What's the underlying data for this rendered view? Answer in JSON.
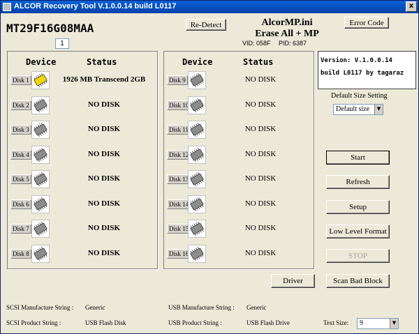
{
  "window": {
    "title": "ALCOR Recovery Tool V.1.0.0.14 build L0117",
    "close_glyph": "x"
  },
  "header": {
    "model": "MT29F16G08MAA",
    "number_field": "1",
    "redetect_label": "Re-Detect",
    "ini_title": "AlcorMP.ini",
    "ini_subtitle": "Erase All + MP",
    "vid": "VID: 058F",
    "pid": "PID: 6387",
    "error_code_label": "Error Code"
  },
  "panels": {
    "device_header": "Device",
    "status_header": "Status"
  },
  "left_disks": [
    {
      "label": "Disk 1",
      "status": "1926 MB Transcend 2GB",
      "icon": "chip-icon-active"
    },
    {
      "label": "Disk 2",
      "status": "NO DISK",
      "icon": "chip-icon"
    },
    {
      "label": "Disk 3",
      "status": "NO DISK",
      "icon": "chip-icon"
    },
    {
      "label": "Disk 4",
      "status": "NO DISK",
      "icon": "chip-icon"
    },
    {
      "label": "Disk 5",
      "status": "NO DISK",
      "icon": "chip-icon"
    },
    {
      "label": "Disk 6",
      "status": "NO DISK",
      "icon": "chip-icon"
    },
    {
      "label": "Disk 7",
      "status": "NO DISK",
      "icon": "chip-icon"
    },
    {
      "label": "Disk 8",
      "status": "NO DISK",
      "icon": "chip-icon"
    }
  ],
  "right_disks": [
    {
      "label": "Disk 9",
      "status": "NO DISK",
      "icon": "chip-icon"
    },
    {
      "label": "Disk 10",
      "status": "NO DISK",
      "icon": "chip-icon"
    },
    {
      "label": "Disk 11",
      "status": "NO DISK",
      "icon": "chip-icon"
    },
    {
      "label": "Disk 12",
      "status": "NO DISK",
      "icon": "chip-icon"
    },
    {
      "label": "Disk 13",
      "status": "NO DISK",
      "icon": "chip-icon"
    },
    {
      "label": "Disk 14",
      "status": "NO DISK",
      "icon": "chip-icon"
    },
    {
      "label": "Disk 15",
      "status": "NO DISK",
      "icon": "chip-icon"
    },
    {
      "label": "Disk 16",
      "status": "NO DISK",
      "icon": "chip-icon"
    }
  ],
  "version": {
    "line1": "Version: V.1.0.0.14",
    "line2": "build L0117 by tagaraz"
  },
  "size_setting": {
    "label": "Default Size Setting",
    "value": "Default size"
  },
  "actions": {
    "start": "Start",
    "refresh": "Refresh",
    "setup": "Setup",
    "low_level_format": "Low Level Format",
    "stop": "STOP",
    "scan_bad_block": "Scan Bad Block",
    "driver": "Driver"
  },
  "footer": {
    "scsi_manufacture_label": "SCSI Manufacture String :",
    "scsi_manufacture_value": "Generic",
    "scsi_product_label": "SCSI Product String :",
    "scsi_product_value": "USB Flash Disk",
    "usb_manufacture_label": "USB Manufacture String :",
    "usb_manufacture_value": "Generic",
    "usb_product_label": "USB Product String :",
    "usb_product_value": "USB Flash Drive",
    "text_size_label": "Text Size:",
    "text_size_value": "9"
  },
  "colors": {
    "active_chip": "#f2d600",
    "inactive_chip": "#8c8c8c"
  }
}
